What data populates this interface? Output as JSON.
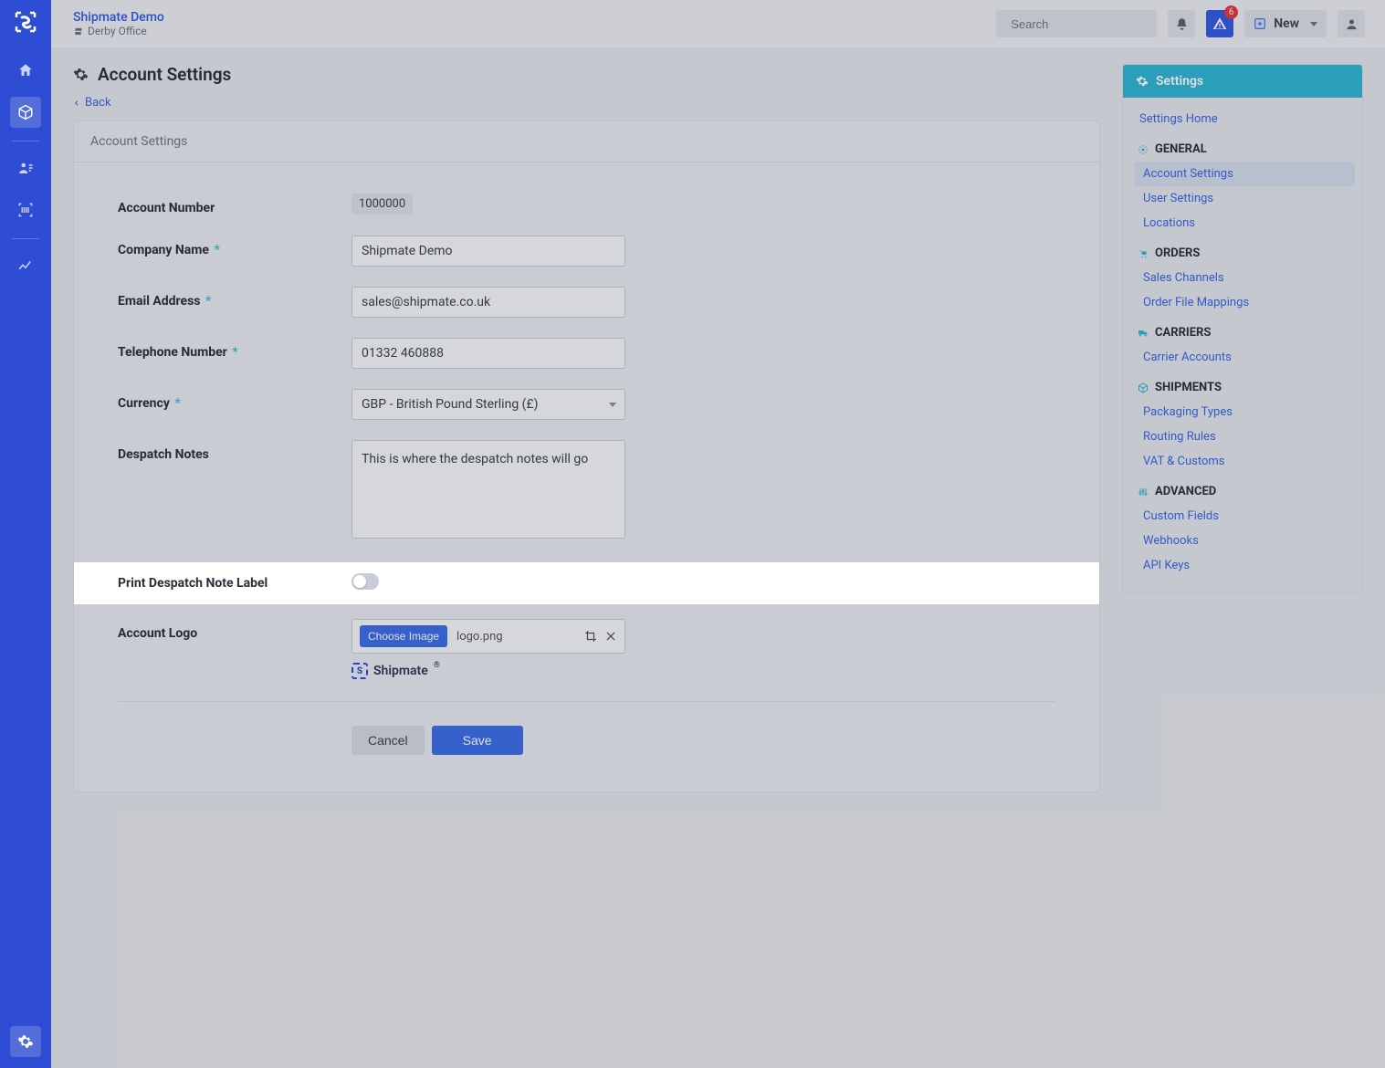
{
  "header": {
    "brand_title": "Shipmate Demo",
    "brand_sub": "Derby Office",
    "search_placeholder": "Search",
    "search_kbd": "/",
    "alert_badge": "6",
    "new_label": "New"
  },
  "page": {
    "title": "Account Settings",
    "back_label": "Back",
    "panel_head": "Account Settings"
  },
  "form": {
    "account_number": {
      "label": "Account Number",
      "value": "1000000"
    },
    "company_name": {
      "label": "Company Name",
      "value": "Shipmate Demo"
    },
    "email": {
      "label": "Email Address",
      "value": "sales@shipmate.co.uk"
    },
    "telephone": {
      "label": "Telephone Number",
      "value": "01332 460888"
    },
    "currency": {
      "label": "Currency",
      "value": "GBP - British Pound Sterling (£)"
    },
    "despatch_notes": {
      "label": "Despatch Notes",
      "value": "This is where the despatch notes will go"
    },
    "print_label": {
      "label": "Print Despatch Note Label"
    },
    "logo": {
      "label": "Account Logo",
      "choose": "Choose Image",
      "filename": "logo.png",
      "preview_text": "Shipmate"
    },
    "buttons": {
      "cancel": "Cancel",
      "save": "Save"
    }
  },
  "side": {
    "title": "Settings",
    "home": "Settings Home",
    "groups": {
      "general": {
        "title": "GENERAL",
        "items": [
          "Account Settings",
          "User Settings",
          "Locations"
        ]
      },
      "orders": {
        "title": "ORDERS",
        "items": [
          "Sales Channels",
          "Order File Mappings"
        ]
      },
      "carriers": {
        "title": "CARRIERS",
        "items": [
          "Carrier Accounts"
        ]
      },
      "shipments": {
        "title": "SHIPMENTS",
        "items": [
          "Packaging Types",
          "Routing Rules",
          "VAT & Customs"
        ]
      },
      "advanced": {
        "title": "ADVANCED",
        "items": [
          "Custom Fields",
          "Webhooks",
          "API Keys"
        ]
      }
    }
  }
}
